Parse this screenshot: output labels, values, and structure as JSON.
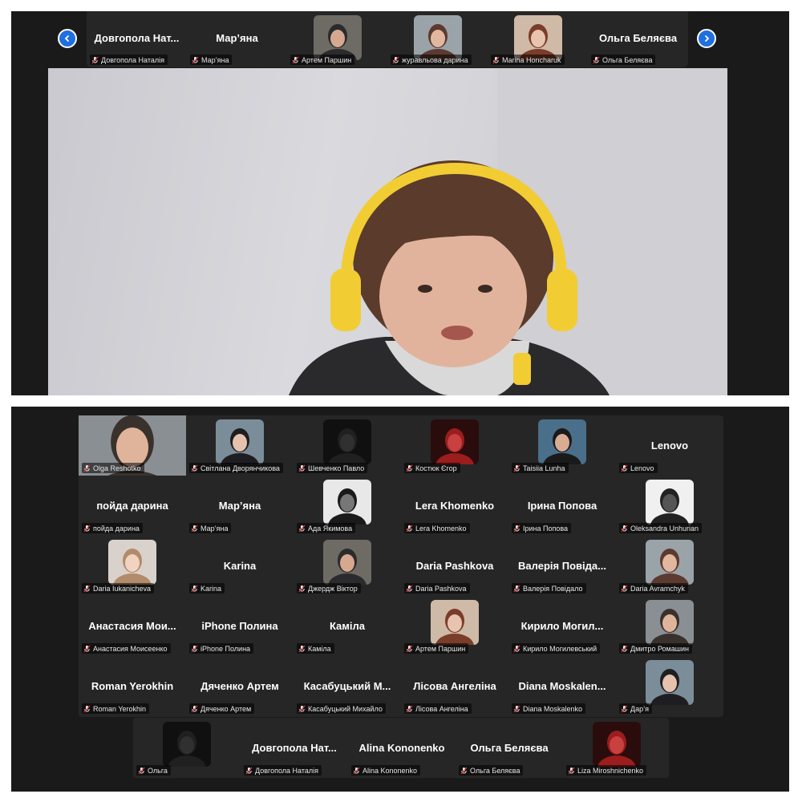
{
  "top_strip": {
    "tiles": [
      {
        "display_name": "Довгопола Нат...",
        "label": "Довгопола Наталія",
        "has_video": false
      },
      {
        "display_name": "Мар’яна",
        "label": "Мар’яна",
        "has_video": false
      },
      {
        "display_name": "",
        "label": "Артем Паршин",
        "has_video": true
      },
      {
        "display_name": "",
        "label": "журавльова дарина",
        "has_video": true
      },
      {
        "display_name": "",
        "label": "Marina Honcharuk",
        "has_video": true
      },
      {
        "display_name": "Ольга Беляєва",
        "label": "Ольга Беляєва",
        "has_video": false
      }
    ]
  },
  "gallery": {
    "rows": [
      [
        {
          "display_name": "",
          "label": "Olga Reshotko",
          "has_video": true,
          "active": true
        },
        {
          "display_name": "",
          "label": "Світлана Дворянчикова",
          "has_video": true
        },
        {
          "display_name": "",
          "label": "Шевченко Павло",
          "has_video": true
        },
        {
          "display_name": "",
          "label": "Костюк Єгор",
          "has_video": true
        },
        {
          "display_name": "",
          "label": "Taisiia Lunha",
          "has_video": true
        },
        {
          "display_name": "Lenovo",
          "label": "Lenovo",
          "has_video": false
        }
      ],
      [
        {
          "display_name": "пойда дарина",
          "label": "пойда дарина",
          "has_video": false
        },
        {
          "display_name": "Мар’яна",
          "label": "Мар’яна",
          "has_video": false
        },
        {
          "display_name": "",
          "label": "Ада Якимова",
          "has_video": true
        },
        {
          "display_name": "Lera Khomenko",
          "label": "Lera Khomenko",
          "has_video": false
        },
        {
          "display_name": "Ірина Попова",
          "label": "Ірина Попова",
          "has_video": false
        },
        {
          "display_name": "",
          "label": "Oleksandra Unhurian",
          "has_video": true
        }
      ],
      [
        {
          "display_name": "",
          "label": "Daria Iukanicheva",
          "has_video": true
        },
        {
          "display_name": "Karina",
          "label": "Karina",
          "has_video": false
        },
        {
          "display_name": "",
          "label": "Джердж Віктор",
          "has_video": true
        },
        {
          "display_name": "Daria Pashkova",
          "label": "Daria Pashkova",
          "has_video": false
        },
        {
          "display_name": "Валерія Повіда...",
          "label": "Валерія Повідало",
          "has_video": false
        },
        {
          "display_name": "",
          "label": "Daria Avramchyk",
          "has_video": true
        }
      ],
      [
        {
          "display_name": "Анастасия Мои...",
          "label": "Анастасия Моисеенко",
          "has_video": false
        },
        {
          "display_name": "iPhone Полина",
          "label": "iPhone Полина",
          "has_video": false
        },
        {
          "display_name": "Каміла",
          "label": "Каміла",
          "has_video": false
        },
        {
          "display_name": "",
          "label": "Артем Паршин",
          "has_video": true
        },
        {
          "display_name": "Кирило Могил...",
          "label": "Кирило Могилевський",
          "has_video": false
        },
        {
          "display_name": "",
          "label": "Дмитро Ромашин",
          "has_video": true
        }
      ],
      [
        {
          "display_name": "Roman Yerokhin",
          "label": "Roman Yerokhin",
          "has_video": false
        },
        {
          "display_name": "Дяченко Артем",
          "label": "Дяченко Артем",
          "has_video": false
        },
        {
          "display_name": "Касабуцький М...",
          "label": "Касабуцький Михайло",
          "has_video": false
        },
        {
          "display_name": "Лісова Ангеліна",
          "label": "Лісова Ангеліна",
          "has_video": false
        },
        {
          "display_name": "Diana Moskalen...",
          "label": "Diana Moskalenko",
          "has_video": false
        },
        {
          "display_name": "",
          "label": "Дар’я",
          "has_video": true
        }
      ]
    ],
    "last_row": [
      {
        "display_name": "",
        "label": "Ольга",
        "has_video": true
      },
      {
        "display_name": "Довгопола Нат...",
        "label": "Довгопола Наталія",
        "has_video": false
      },
      {
        "display_name": "Alina Kononenko",
        "label": "Alina Kononenko",
        "has_video": false
      },
      {
        "display_name": "Ольга Беляєва",
        "label": "Ольга Беляєва",
        "has_video": false
      },
      {
        "display_name": "",
        "label": "Liza Miroshnichenko",
        "has_video": true
      }
    ]
  },
  "colors": {
    "panel_bg": "#1a1a1a",
    "tile_bg": "#262626",
    "nav_blue": "#1f6fe0",
    "active_border": "#35d07f",
    "muted_mic": "#e23b3b"
  },
  "icons": {
    "muted": "mic-muted-icon",
    "prev": "chevron-left-icon",
    "next": "chevron-right-icon"
  }
}
